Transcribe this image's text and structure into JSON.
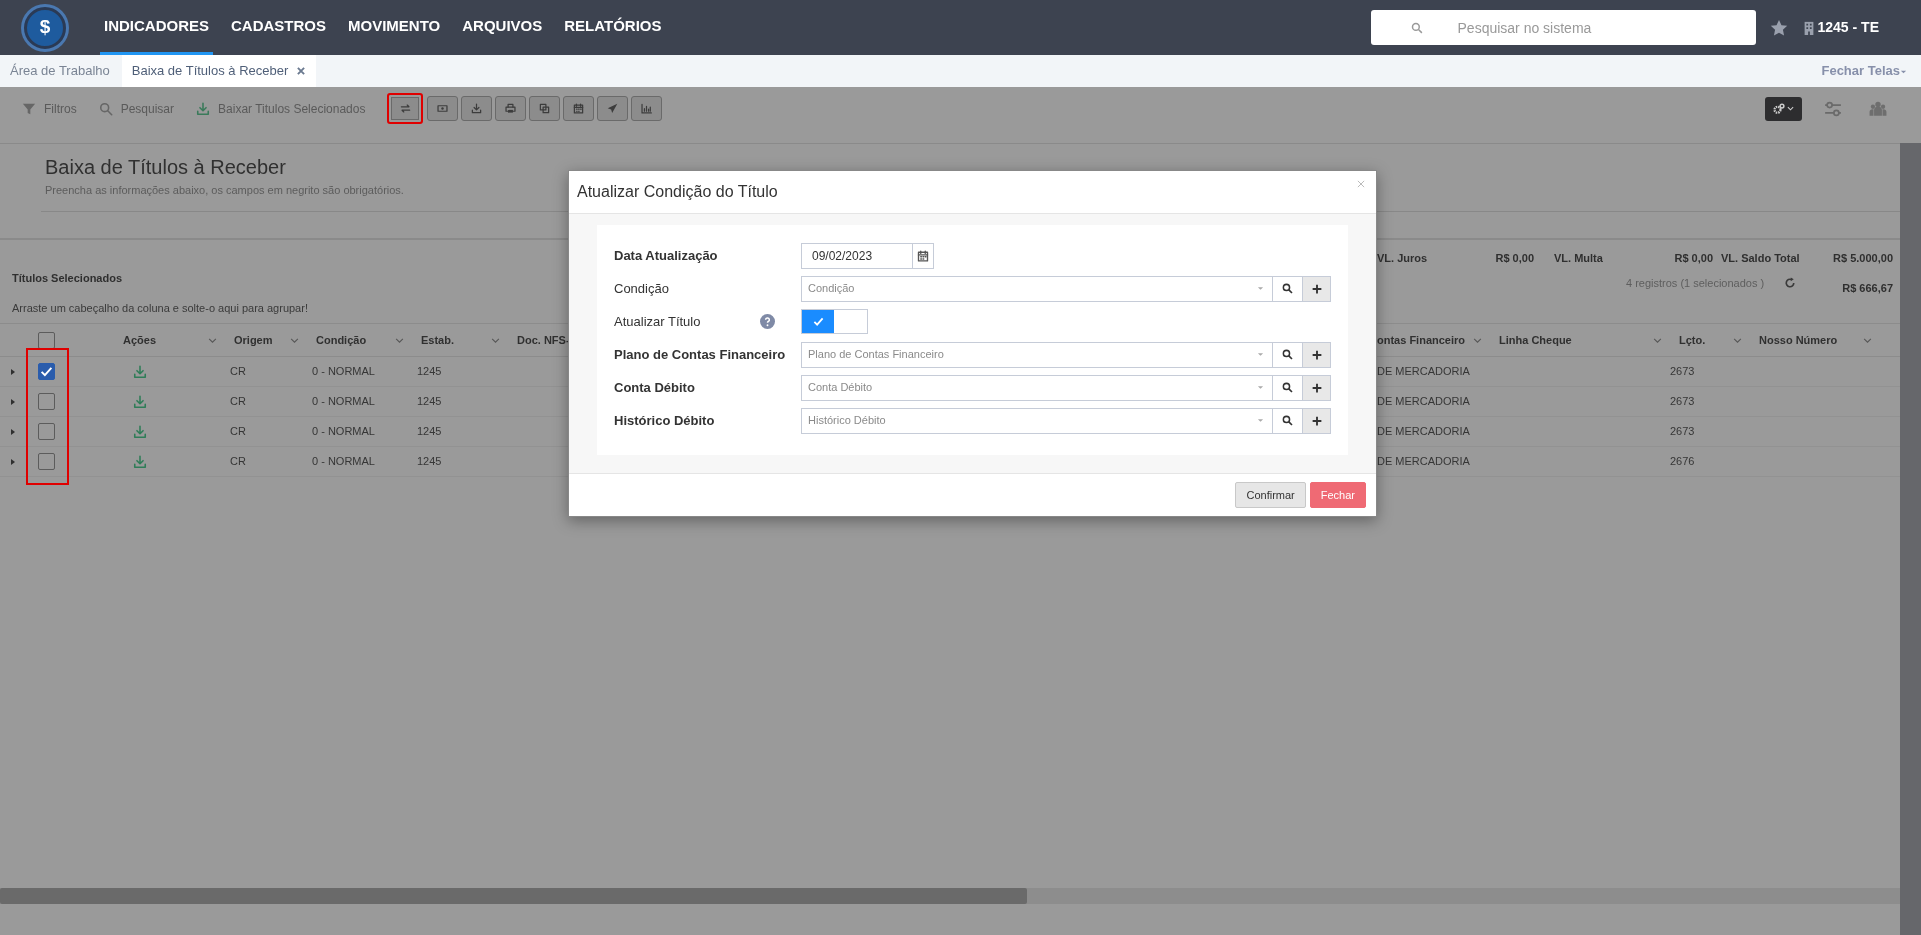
{
  "navbar": {
    "logo_symbol": "$",
    "menu": [
      {
        "label": "INDICADORES",
        "selected": true
      },
      {
        "label": "CADASTROS",
        "selected": false
      },
      {
        "label": "MOVIMENTO",
        "selected": false
      },
      {
        "label": "ARQUIVOS",
        "selected": false
      },
      {
        "label": "RELATÓRIOS",
        "selected": false
      }
    ],
    "search": {
      "placeholder": "Pesquisar no sistema"
    },
    "company": "1245 - TE"
  },
  "screen_tabs": [
    {
      "label": "Área de Trabalho",
      "selected": false,
      "closable": false
    },
    {
      "label": "Baixa de Títulos à Receber",
      "selected": true,
      "closable": true
    }
  ],
  "close_all": "Fechar Telas",
  "toolbar": {
    "actions": [
      {
        "label": "Filtros",
        "kind": "filter"
      },
      {
        "label": "Pesquisar",
        "kind": "search"
      },
      {
        "label": "Baixar Titulos Selecionados",
        "kind": "download"
      }
    ],
    "icon_buttons": [
      {
        "kind": "swap",
        "highlighted": true
      },
      {
        "kind": "cash",
        "highlighted": false
      },
      {
        "kind": "download",
        "highlighted": false
      },
      {
        "kind": "print",
        "highlighted": false
      },
      {
        "kind": "copy",
        "highlighted": false
      },
      {
        "kind": "calendar",
        "highlighted": false
      },
      {
        "kind": "send",
        "highlighted": false
      },
      {
        "kind": "chart",
        "highlighted": false
      }
    ]
  },
  "page": {
    "title": "Baixa de Títulos à Receber",
    "subtitle": "Preencha as informações abaixo, os campos em negrito são obrigatórios."
  },
  "selected_titles": {
    "title": "Títulos Selecionados",
    "group_hint": "Arraste um cabeçalho da coluna e solte-o aqui para agrupar!",
    "totals": [
      {
        "label": "VL. Juros",
        "value": "R$ 0,00"
      },
      {
        "label": "VL. Multa",
        "value": "R$ 0,00"
      },
      {
        "label": "VL. Saldo Total",
        "value": "R$ 5.000,00"
      }
    ],
    "record_count": "4 registros (1 selecionados )",
    "selected_total": "R$ 666,67"
  },
  "table": {
    "header_checked": false,
    "checkbox_column_highlighted": true,
    "columns": [
      {
        "label": "Ações",
        "menu": true
      },
      {
        "label": "Origem",
        "menu": true
      },
      {
        "label": "Condição",
        "menu": true
      },
      {
        "label": "Estab.",
        "menu": true
      },
      {
        "label": "Doc. NFS-",
        "menu": false
      },
      {
        "label": "ontas Financeiro",
        "menu": true
      },
      {
        "label": "Linha Cheque",
        "menu": true
      },
      {
        "label": "Lçto.",
        "menu": true
      },
      {
        "label": "Nosso Número",
        "menu": true
      }
    ],
    "rows": [
      {
        "checked": true,
        "origin": "CR",
        "condition": "0 - NORMAL",
        "branch": "1245",
        "account": "DE MERCADORIA",
        "entry": "2673"
      },
      {
        "checked": false,
        "origin": "CR",
        "condition": "0 - NORMAL",
        "branch": "1245",
        "account": "DE MERCADORIA",
        "entry": "2673"
      },
      {
        "checked": false,
        "origin": "CR",
        "condition": "0 - NORMAL",
        "branch": "1245",
        "account": "DE MERCADORIA",
        "entry": "2673"
      },
      {
        "checked": false,
        "origin": "CR",
        "condition": "0 - NORMAL",
        "branch": "1245",
        "account": "DE MERCADORIA",
        "entry": "2676"
      }
    ]
  },
  "modal": {
    "title": "Atualizar Condição do Título",
    "fields": [
      {
        "label": "Data Atualização",
        "bold": true,
        "kind": "date",
        "value": "09/02/2023"
      },
      {
        "label": "Condição",
        "bold": false,
        "kind": "select",
        "placeholder": "Condição"
      },
      {
        "label": "Atualizar Título",
        "bold": false,
        "kind": "toggle",
        "on": true,
        "help": true
      },
      {
        "label": "Plano de Contas Financeiro",
        "bold": true,
        "kind": "select",
        "placeholder": "Plano de Contas Financeiro"
      },
      {
        "label": "Conta Débito",
        "bold": true,
        "kind": "select",
        "placeholder": "Conta Débito"
      },
      {
        "label": "Histórico Débito",
        "bold": true,
        "kind": "select",
        "placeholder": "Histórico Débito"
      }
    ],
    "buttons": [
      {
        "label": "Confirmar",
        "kind": "secondary"
      },
      {
        "label": "Fechar",
        "kind": "danger"
      }
    ]
  }
}
